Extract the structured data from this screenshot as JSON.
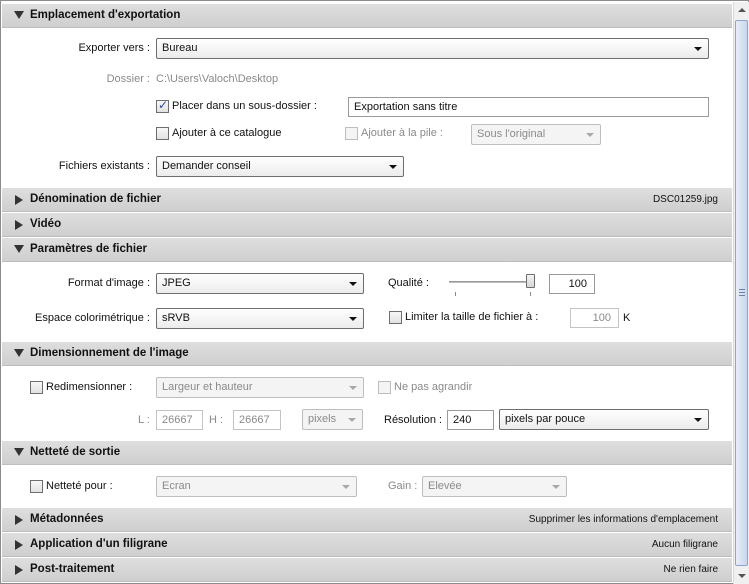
{
  "sections": {
    "export_location": {
      "title": "Emplacement d'exportation",
      "export_to_label": "Exporter vers :",
      "export_to_value": "Bureau",
      "folder_label": "Dossier :",
      "folder_value": "C:\\Users\\Valoch\\Desktop",
      "subfolder_label": "Placer dans un sous-dossier :",
      "subfolder_checked": true,
      "subfolder_value": "Exportation sans titre",
      "add_catalog_label": "Ajouter à ce catalogue",
      "add_stack_label": "Ajouter à la pile :",
      "stack_position_value": "Sous l'original",
      "existing_files_label": "Fichiers existants :",
      "existing_files_value": "Demander conseil"
    },
    "file_naming": {
      "title": "Dénomination de fichier",
      "summary": "DSC01259.jpg"
    },
    "video": {
      "title": "Vidéo"
    },
    "file_settings": {
      "title": "Paramètres de fichier",
      "format_label": "Format d'image :",
      "format_value": "JPEG",
      "quality_label": "Qualité :",
      "quality_value": "100",
      "quality_level": 1.0,
      "color_space_label": "Espace colorimétrique :",
      "color_space_value": "sRVB",
      "limit_size_label": "Limiter la taille de fichier à :",
      "limit_size_value": "100",
      "limit_size_unit": "K"
    },
    "image_sizing": {
      "title": "Dimensionnement de l'image",
      "resize_label": "Redimensionner :",
      "resize_mode_value": "Largeur et hauteur",
      "dont_enlarge_label": "Ne pas agrandir",
      "width_label": "L :",
      "width_value": "26667",
      "height_label": "H :",
      "height_value": "26667",
      "units_value": "pixels",
      "resolution_label": "Résolution :",
      "resolution_value": "240",
      "resolution_unit_value": "pixels par pouce"
    },
    "output_sharpening": {
      "title": "Netteté de sortie",
      "sharpen_for_label": "Netteté pour :",
      "sharpen_for_value": "Ecran",
      "amount_label": "Gain :",
      "amount_value": "Elevée"
    },
    "metadata": {
      "title": "Métadonnées",
      "summary": "Supprimer les informations d'emplacement"
    },
    "watermarking": {
      "title": "Application d'un filigrane",
      "summary": "Aucun filigrane"
    },
    "post_processing": {
      "title": "Post-traitement",
      "summary": "Ne rien faire"
    }
  }
}
